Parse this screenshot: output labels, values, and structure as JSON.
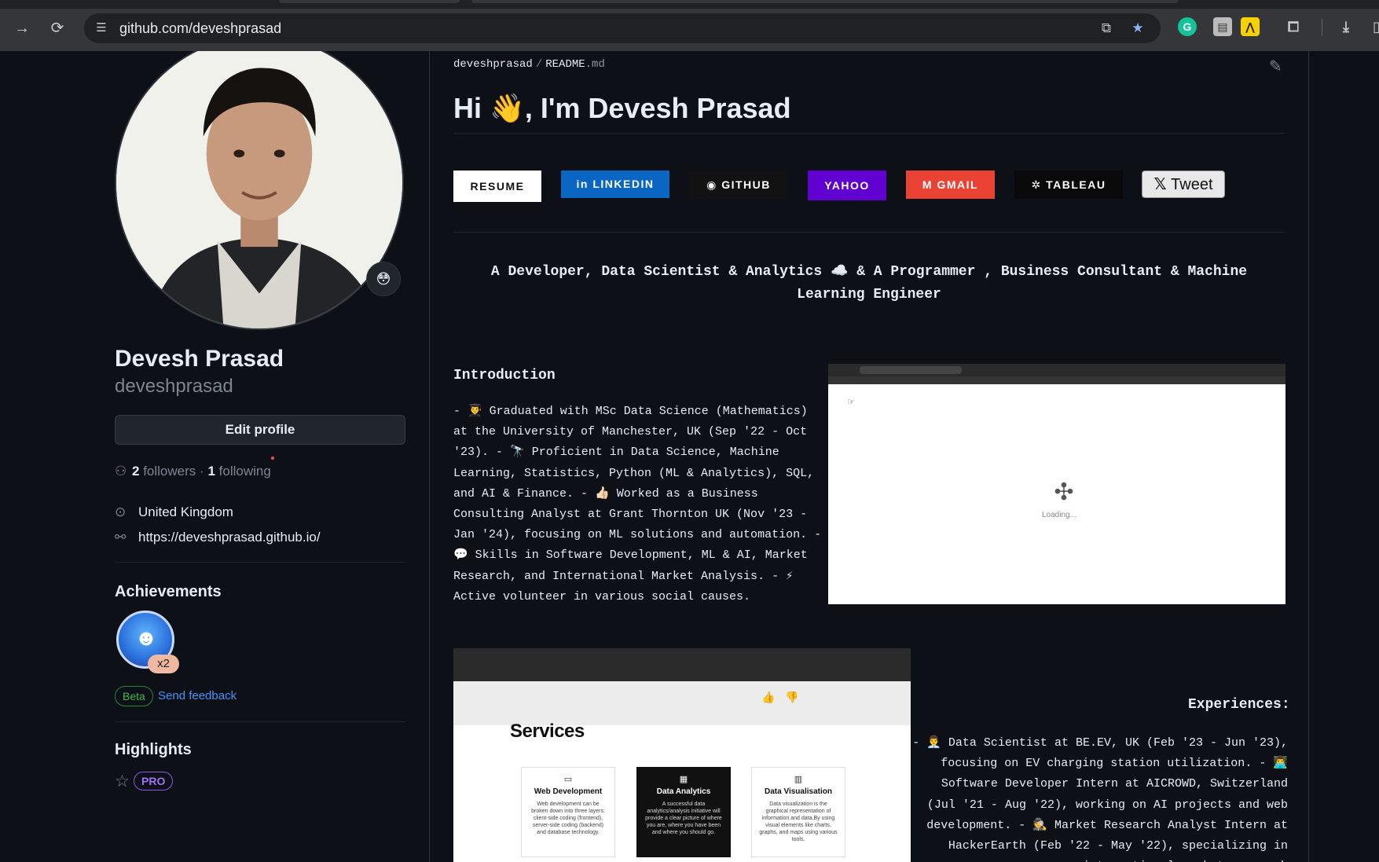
{
  "browser": {
    "url": "github.com/deveshprasad",
    "icons": {
      "forward": "forward-arrow-icon",
      "reload": "reload-icon",
      "site_info": "tune-icon",
      "install": "install-app-icon",
      "bookmark": "bookmark-star-icon",
      "downloads": "download-icon",
      "extensions": "puzzle-icon"
    }
  },
  "profile": {
    "name": "Devesh Prasad",
    "username": "deveshprasad",
    "status_emoji": "😳",
    "edit_button": "Edit profile",
    "followers_count": "2",
    "followers_label": "followers",
    "dot_sep": "·",
    "following_count": "1",
    "following_label": "following",
    "location": "United Kingdom",
    "website": "https://deveshprasad.github.io/",
    "achievements_heading": "Achievements",
    "achievement_multiplier": "x2",
    "beta_label": "Beta",
    "feedback_link": "Send feedback",
    "highlights_heading": "Highlights",
    "pro_label": "PRO"
  },
  "readme": {
    "path_user": "deveshprasad",
    "path_sep": "/",
    "path_file": "README",
    "path_ext": ".md",
    "title": "Hi 👋, I'm Devesh Prasad",
    "badges": [
      {
        "label": "RESUME",
        "bg": "#ffffff",
        "fg": "#111111"
      },
      {
        "label": "LINKEDIN",
        "bg": "#0a66c2",
        "fg": "#ffffff"
      },
      {
        "label": "GITHUB",
        "bg": "#121212",
        "fg": "#ffffff"
      },
      {
        "label": "YAHOO",
        "bg": "#6001d2",
        "fg": "#ffffff"
      },
      {
        "label": "GMAIL",
        "bg": "#ea4335",
        "fg": "#ffffff"
      },
      {
        "label": "TABLEAU",
        "bg": "#0a0a0a",
        "fg": "#ffffff"
      },
      {
        "label": "Tweet",
        "bg": "#e8e8e8",
        "fg": "#111111"
      }
    ],
    "tagline": "A Developer, Data Scientist & Analytics ☁️ & A Programmer , Business Consultant & Machine Learning Engineer",
    "intro_heading": "Introduction",
    "intro_text": "- 👨‍🎓 Graduated with MSc Data Science (Mathematics) at the University of Manchester, UK (Sep '22 - Oct '23). - 🔭 Proficient in Data Science, Machine Learning, Statistics, Python (ML & Analytics), SQL, and AI & Finance. - 👍🏻 Worked as a Business Consulting Analyst at Grant Thornton UK (Nov '23 - Jan '24), focusing on ML solutions and automation. - 💬 Skills in Software Development, ML & AI, Market Research, and International Market Analysis. - ⚡ Active volunteer in various social causes.",
    "screenshot1_loading": "Loading...",
    "screenshot2_heading": "Services",
    "services": [
      {
        "title": "Web Development",
        "desc": "Web development can be broken down into three layers: client-side coding (frontend), server-side coding (backend) and database technology."
      },
      {
        "title": "Data Analytics",
        "desc": "A successful data analytics/analysis initiative will provide a clear picture of where you are, where you have been and where you should go."
      },
      {
        "title": "Data Visualisation",
        "desc": "Data visualization is the graphical representation of information and data.By using visual elements like charts, graphs, and maps using various tools."
      }
    ],
    "experiences_heading": "Experiences:",
    "experiences_text": "- 👨‍💼 Data Scientist at BE.EV, UK (Feb '23 - Jun '23), focusing on EV charging station utilization. - 👨‍💻 Software Developer Intern at AICROWD, Switzerland (Jul '21 - Aug '22), working on AI projects and web development. - 🕵️ Market Research Analyst Intern at HackerEarth (Feb '22 - May '22), specializing in international market research"
  }
}
